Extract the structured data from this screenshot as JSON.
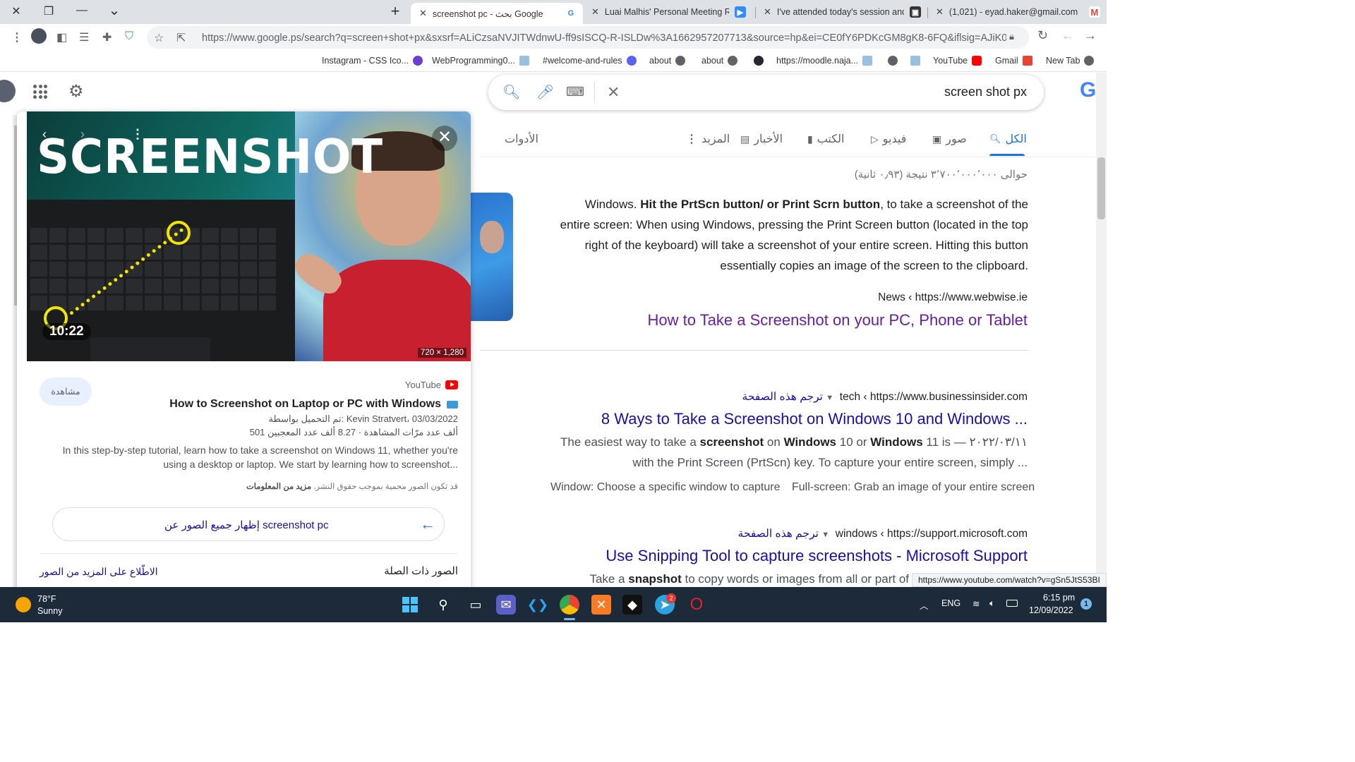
{
  "window": {
    "close_glyph": "✕",
    "restore_glyph": "❐",
    "minimize_glyph": "—",
    "dropdown_glyph": "⌄"
  },
  "tabs": [
    {
      "title": "screenshot pc - بحث Google",
      "favicon": "G",
      "active": true
    },
    {
      "title": "Luai Malhis' Personal Meeting Ro",
      "favicon": "zoom"
    },
    {
      "title": "I've attended today's session and",
      "favicon": "contact"
    },
    {
      "title": "(1,021) - eyad.haker@gmail.com",
      "favicon": "gmail"
    }
  ],
  "new_tab_glyph": "+",
  "address_bar": {
    "url": "https://www.google.ps/search?q=screen+shot+px&sxsrf=ALiCzsaNVJITWdnwU-ff9sISCQ-R-ISLDw%3A1662957207713&source=hp&ei=CE0fY6PDKcGM8gK8-6FQ&iflsig=AJiK0e8A..."
  },
  "bookmarks": [
    {
      "label": "Instagram - CSS Ico...",
      "icon_color": "#6c3fd1"
    },
    {
      "label": "WebProgramming0...",
      "icon_color": "#9ac0e0"
    },
    {
      "label": "#welcome-and-rules",
      "icon_color": "#5865f2"
    },
    {
      "label": "about",
      "icon_color": "#5f6368"
    },
    {
      "label": "about",
      "icon_color": "#5f6368"
    },
    {
      "label": "https://moodle.naja...",
      "icon_color": "#24292f"
    },
    {
      "label": "YouTube",
      "icon_color": "#ff0000"
    },
    {
      "label": "Gmail",
      "icon_color": "#ea4335"
    },
    {
      "label": "New Tab",
      "icon_color": "#5f6368"
    }
  ],
  "search": {
    "query": "screen shot px",
    "clear_glyph": "✕"
  },
  "nav_tabs": [
    {
      "label": "الكل",
      "active": true
    },
    {
      "label": "صور"
    },
    {
      "label": "فيديو"
    },
    {
      "label": "الكتب"
    },
    {
      "label": "الأخبار"
    },
    {
      "label": "المزيد"
    },
    {
      "label": "الأدوات"
    }
  ],
  "result_stats": "حوالى ٣٬٧٠٠٬٠٠٠٬٠٠٠ نتيجة (٠٫٩٣ ثانية)",
  "featured": {
    "snippet_pre": "Windows. ",
    "snippet_bold": "Hit the PrtScn button/ or Print Scrn button",
    "snippet_post": ", to take a screenshot of the entire screen: When using Windows, pressing the Print Screen button (located in the top right of the keyboard) will take a screenshot of your entire screen. Hitting this button essentially copies an image of the screen to the clipboard.",
    "cite": "News ‹ https://www.webwise.ie",
    "title": "How to Take a Screenshot on your PC, Phone or Tablet"
  },
  "results": [
    {
      "translate": "ترجم هذه الصفحة",
      "cite": "tech ‹ https://www.businessinsider.com",
      "title": "8 Ways to Take a Screenshot on Windows 10 and Windows ...",
      "desc_line1_pre": "The easiest way to take a ",
      "desc_line1_b1": "screenshot",
      "desc_line1_mid": " on ",
      "desc_line1_b2": "Windows",
      "desc_line1_mid2": " 10 or ",
      "desc_line1_b3": "Windows",
      "desc_line1_post": " 11 is — ٢٠٢٢/٠٣/١١",
      "desc_line2": "with the Print Screen (PrtScn) key. To capture your entire screen, simply ...",
      "sublinks": [
        "Full-screen: Grab an image of your entire screen",
        "Window: Choose a specific window to capture"
      ]
    },
    {
      "translate": "ترجم هذه الصفحة",
      "cite": "windows ‹ https://support.microsoft.com",
      "title": "Use Snipping Tool to capture screenshots - Microsoft Support",
      "desc_pre": "Take a ",
      "desc_b": "snapshot",
      "desc_post": " to copy words or images from all or part of"
    }
  ],
  "preview": {
    "overlay_title": "SCREENSHOT",
    "duration": "10:22",
    "dimensions": "720 × 1,280",
    "source": "YouTube",
    "title": "How to Screenshot on Laptop or PC with Windows",
    "meta_upload": "تم التحميل بواسطة: Kevin Stratvert، 03/03/2022",
    "meta_stats": "501 ألف عدد مرّات المشاهدة · 8.27 ألف عدد المعجبين",
    "description": "In this step-by-step tutorial, learn how to take a screenshot on Windows 11, whether you're using a desktop or laptop. We start by learning how to screenshot...",
    "copyright_pre": "قد تكون الصور محمية بموجب حقوق النشر. ",
    "copyright_link": "مزيد من المعلومات",
    "watch_label": "مشاهدة",
    "show_all_label": "إظهار جميع الصور عن screenshot pc",
    "related_label": "الصور ذات الصلة",
    "more_images_label": "الاطّلاع على المزيد من الصور"
  },
  "status_url": "https://www.youtube.com/watch?v=gSn5JtS53BI",
  "taskbar": {
    "weather_temp": "78°F",
    "weather_desc": "Sunny",
    "language": "ENG",
    "time": "6:15 pm",
    "date": "12/09/2022",
    "notification_count": "1",
    "telegram_badge": "2"
  }
}
